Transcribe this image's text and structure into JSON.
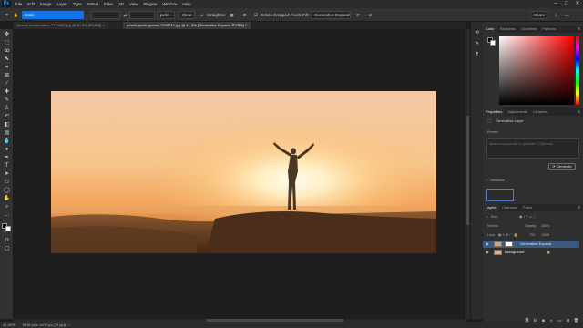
{
  "menu": {
    "logo": "Ps",
    "items": [
      "File",
      "Edit",
      "Image",
      "Layer",
      "Type",
      "Select",
      "Filter",
      "3D",
      "View",
      "Plugins",
      "Window",
      "Help"
    ]
  },
  "window_controls": {
    "minimize": "–",
    "maximize": "□",
    "close": "✕"
  },
  "options": {
    "ratio_value": "Ratio",
    "unit": "px/in",
    "clear": "Clear",
    "straighten": "Straighten",
    "delete_cropped": "Delete Cropped Pixels",
    "fill_label": "Fill:",
    "fill_value": "Generative Expand",
    "share": "Share"
  },
  "tabs": [
    {
      "label": "pexels-koolshooters-7142097.jpg @ 40,3% (RGB/8) ×",
      "active": false
    },
    {
      "label": "pexels-jacob-gomez-1568744.jpg @ 41,3% (Generative Expand, RGB/8) *",
      "active": true
    }
  ],
  "status": {
    "zoom": "41,32%",
    "dims": "5016 px x 1200 px (72 ppi)"
  },
  "color_panel": {
    "tabs": [
      "Color",
      "Swatches",
      "Gradients",
      "Patterns"
    ],
    "fg": "#000000",
    "bg": "#ffffff"
  },
  "properties_panel": {
    "tabs": [
      "Properties",
      "Adjustments",
      "Libraries"
    ],
    "layer_type": "Generative Layer",
    "prompt_label": "Prompt",
    "prompt_placeholder": "What would you like to generate? (Optional)",
    "generate": "Generate",
    "variations": "Variations"
  },
  "layers_panel": {
    "tabs": [
      "Layers",
      "Channels",
      "Paths"
    ],
    "kind": "Kind",
    "blend": "Normal",
    "opacity_label": "Opacity:",
    "opacity_value": "100%",
    "lock_label": "Lock:",
    "fill_label": "Fill:",
    "fill_value": "100%",
    "layers": [
      {
        "name": "Generative Expand",
        "selected": true
      },
      {
        "name": "Background",
        "selected": false
      }
    ],
    "bottom_icons": [
      "link-icon",
      "fx-icon",
      "mask-icon",
      "adjustment-icon",
      "group-icon",
      "new-layer-icon",
      "trash-icon"
    ]
  },
  "colors": {
    "selection": "#3c5a80",
    "accent": "#1473e6"
  }
}
